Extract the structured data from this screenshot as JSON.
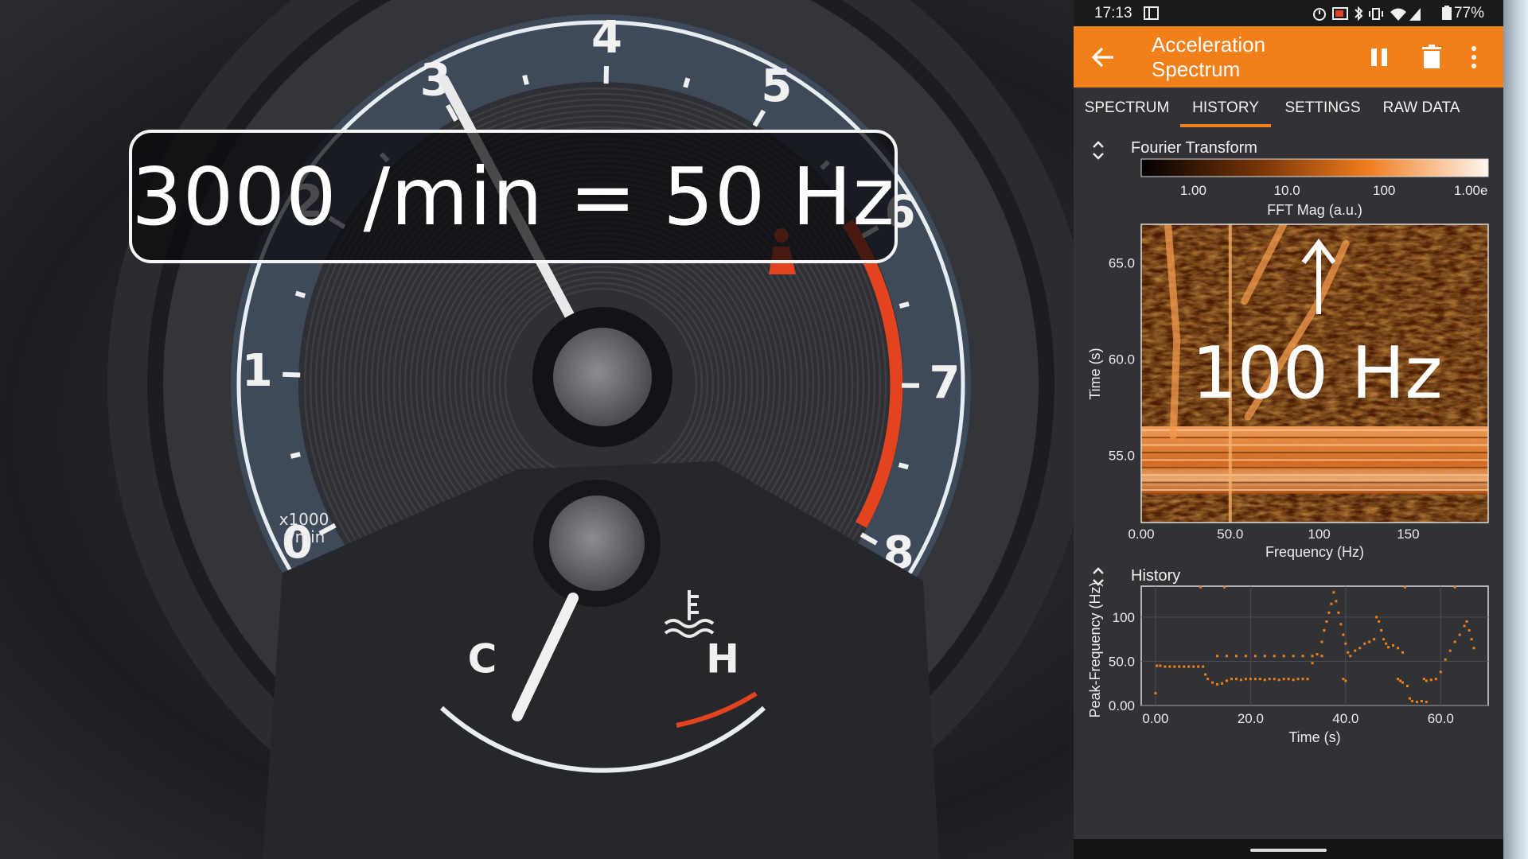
{
  "overlay": {
    "rpm_equation": "3000 /min = 50 Hz",
    "arrow_label": "100 Hz"
  },
  "gauge": {
    "tach_numbers": [
      "0",
      "1",
      "2",
      "3",
      "4",
      "5",
      "6",
      "7",
      "8"
    ],
    "unit_line1": "x1000",
    "unit_line2": "r/min",
    "needle_value_krpm": 3.05,
    "temp_cold": "C",
    "temp_hot": "H"
  },
  "status_bar": {
    "time": "17:13",
    "battery": "77%"
  },
  "app": {
    "title": "Acceleration Spectrum",
    "back_icon": "arrow-left-icon",
    "pause_icon": "pause-icon",
    "delete_icon": "trash-icon",
    "menu_icon": "more-vert-icon",
    "accent_color": "#f17f1a"
  },
  "tabs": [
    {
      "label": "SPECTRUM",
      "selected": false
    },
    {
      "label": "HISTORY",
      "selected": true
    },
    {
      "label": "SETTINGS",
      "selected": false
    },
    {
      "label": "RAW DATA",
      "selected": false
    }
  ],
  "fourier_panel": {
    "title": "Fourier Transform",
    "colorbar_ticks": [
      "1.00",
      "10.0",
      "100",
      "1.00e"
    ],
    "colorbar_label": "FFT Mag (a.u.)"
  },
  "history_panel": {
    "title": "History"
  },
  "chart_data": [
    {
      "type": "heatmap",
      "title": "Fourier Transform",
      "xlabel": "Frequency (Hz)",
      "ylabel": "Time (s)",
      "xlim": [
        0,
        195
      ],
      "ylim": [
        51.5,
        67
      ],
      "x_ticks": [
        "0.00",
        "50.0",
        "100",
        "150"
      ],
      "y_ticks": [
        "55.0",
        "60.0",
        "65.0"
      ],
      "colorbar": {
        "label": "FFT Mag (a.u.)",
        "scale": "log",
        "ticks": [
          "1.00",
          "10.0",
          "100",
          "1.00e"
        ]
      },
      "features": [
        {
          "kind": "broadband_band",
          "time_range": [
            53,
            56.5
          ]
        },
        {
          "kind": "line",
          "freq": 50,
          "time_range": [
            51.5,
            67
          ]
        },
        {
          "kind": "ridge",
          "points": [
            [
              15,
              67
            ],
            [
              20,
              61
            ],
            [
              18,
              56
            ]
          ]
        },
        {
          "kind": "ridge",
          "points": [
            [
              60,
              57
            ],
            [
              100,
              63
            ],
            [
              115,
              66
            ]
          ]
        },
        {
          "kind": "ridge",
          "points": [
            [
              58,
              63
            ],
            [
              80,
              67
            ]
          ]
        }
      ]
    },
    {
      "type": "scatter",
      "title": "History",
      "xlabel": "Time (s)",
      "ylabel": "Peak-Frequency (Hz)",
      "xlim": [
        -3,
        70
      ],
      "ylim": [
        0,
        135
      ],
      "x_ticks": [
        "0.00",
        "20.0",
        "40.0",
        "60.0"
      ],
      "y_ticks": [
        "0.00",
        "50.0",
        "100"
      ],
      "points": [
        [
          0,
          14
        ],
        [
          0.3,
          45
        ],
        [
          1,
          45
        ],
        [
          2,
          44
        ],
        [
          3,
          44
        ],
        [
          4,
          44
        ],
        [
          5,
          44
        ],
        [
          6,
          44
        ],
        [
          7,
          44
        ],
        [
          8,
          44
        ],
        [
          9,
          44
        ],
        [
          10,
          44
        ],
        [
          10.5,
          35
        ],
        [
          11,
          30
        ],
        [
          12,
          26
        ],
        [
          13,
          24
        ],
        [
          14,
          25
        ],
        [
          15,
          28
        ],
        [
          16,
          30
        ],
        [
          17,
          30
        ],
        [
          18,
          29
        ],
        [
          19,
          30
        ],
        [
          20,
          30
        ],
        [
          21,
          30
        ],
        [
          22,
          30
        ],
        [
          23,
          29
        ],
        [
          24,
          30
        ],
        [
          25,
          30
        ],
        [
          26,
          29
        ],
        [
          27,
          30
        ],
        [
          28,
          30
        ],
        [
          29,
          29
        ],
        [
          30,
          30
        ],
        [
          31,
          30
        ],
        [
          32,
          30
        ],
        [
          13,
          56
        ],
        [
          15,
          56
        ],
        [
          17,
          56
        ],
        [
          19,
          56
        ],
        [
          21,
          56
        ],
        [
          23,
          56
        ],
        [
          25,
          56
        ],
        [
          27,
          56
        ],
        [
          29,
          56
        ],
        [
          31,
          56
        ],
        [
          33,
          56
        ],
        [
          35,
          56
        ],
        [
          9.5,
          137
        ],
        [
          14.5,
          137
        ],
        [
          33,
          48
        ],
        [
          34,
          58
        ],
        [
          35,
          72
        ],
        [
          35.5,
          85
        ],
        [
          36,
          95
        ],
        [
          36.5,
          105
        ],
        [
          37,
          115
        ],
        [
          37.5,
          128
        ],
        [
          38,
          118
        ],
        [
          38.5,
          105
        ],
        [
          39,
          92
        ],
        [
          39.5,
          80
        ],
        [
          40,
          70
        ],
        [
          40.5,
          60
        ],
        [
          41,
          56
        ],
        [
          42,
          62
        ],
        [
          43,
          65
        ],
        [
          44,
          70
        ],
        [
          45,
          72
        ],
        [
          46,
          75
        ],
        [
          46.5,
          100
        ],
        [
          47,
          95
        ],
        [
          47.5,
          85
        ],
        [
          48,
          75
        ],
        [
          48.5,
          70
        ],
        [
          49,
          66
        ],
        [
          50,
          68
        ],
        [
          51,
          65
        ],
        [
          52,
          60
        ],
        [
          39.5,
          30
        ],
        [
          40,
          28
        ],
        [
          51,
          30
        ],
        [
          51.5,
          28
        ],
        [
          52,
          26
        ],
        [
          53,
          22
        ],
        [
          53.5,
          8
        ],
        [
          54,
          5
        ],
        [
          55,
          4
        ],
        [
          56,
          5
        ],
        [
          57,
          4
        ],
        [
          56.5,
          30
        ],
        [
          57,
          28
        ],
        [
          58,
          29
        ],
        [
          59,
          30
        ],
        [
          60,
          38
        ],
        [
          61,
          52
        ],
        [
          62,
          62
        ],
        [
          63,
          72
        ],
        [
          64,
          80
        ],
        [
          65,
          90
        ],
        [
          65.5,
          95
        ],
        [
          66,
          85
        ],
        [
          66.5,
          75
        ],
        [
          67,
          65
        ],
        [
          52.5,
          137
        ],
        [
          63,
          137
        ]
      ]
    }
  ]
}
